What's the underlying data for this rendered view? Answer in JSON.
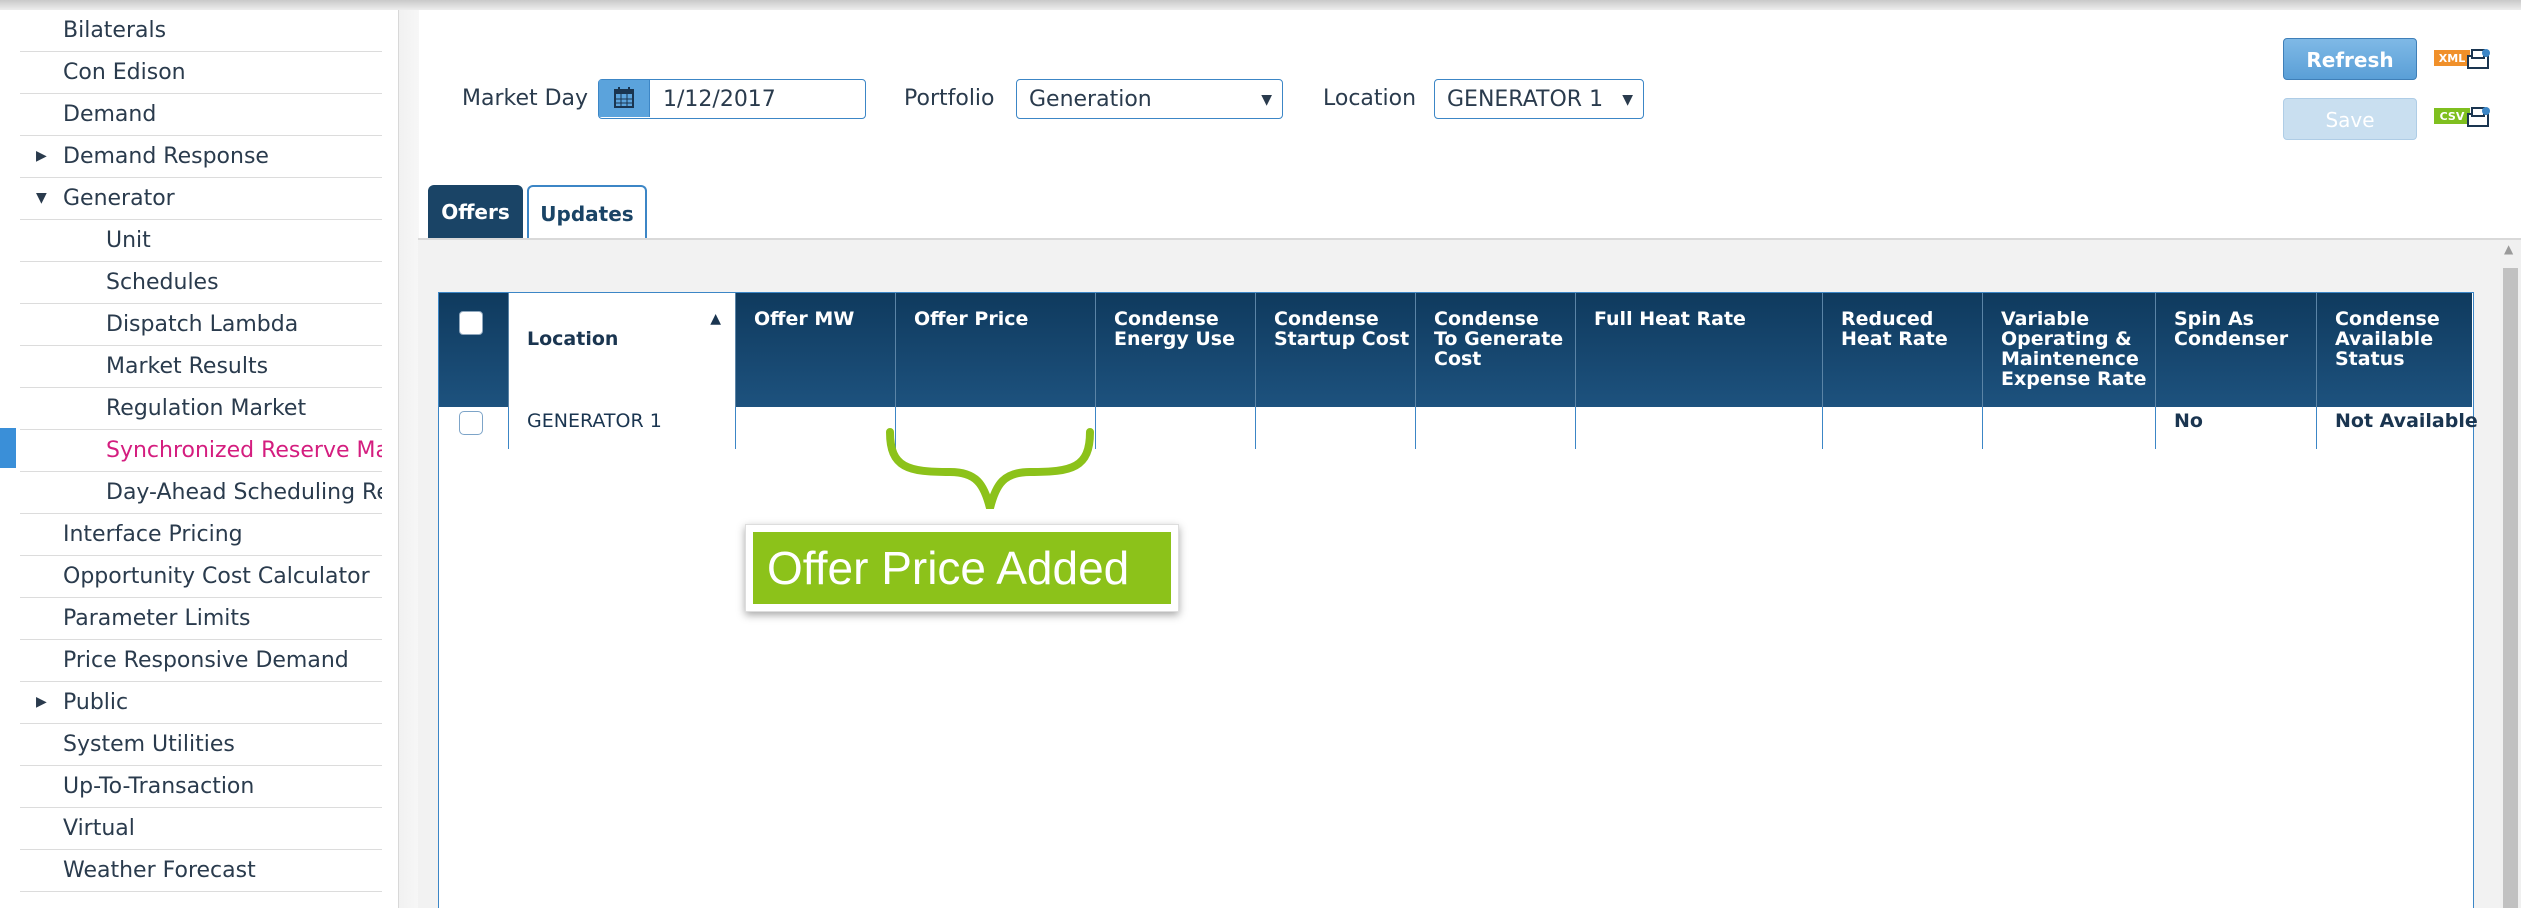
{
  "sidebar": {
    "items": [
      {
        "label": "Bilaterals"
      },
      {
        "label": "Con Edison"
      },
      {
        "label": "Demand"
      },
      {
        "label": "Demand Response"
      },
      {
        "label": "Generator"
      },
      {
        "label": "Unit"
      },
      {
        "label": "Schedules"
      },
      {
        "label": "Dispatch Lambda"
      },
      {
        "label": "Market Results"
      },
      {
        "label": "Regulation Market"
      },
      {
        "label": "Synchronized Reserve Mar"
      },
      {
        "label": "Day-Ahead Scheduling Res"
      },
      {
        "label": "Interface Pricing"
      },
      {
        "label": "Opportunity Cost Calculator"
      },
      {
        "label": "Parameter Limits"
      },
      {
        "label": "Price Responsive Demand"
      },
      {
        "label": "Public"
      },
      {
        "label": "System Utilities"
      },
      {
        "label": "Up-To-Transaction"
      },
      {
        "label": "Virtual"
      },
      {
        "label": "Weather Forecast"
      }
    ],
    "active_color": "#d41d7f"
  },
  "filters": {
    "market_day_label": "Market Day",
    "market_day_value": "1/12/2017",
    "portfolio_label": "Portfolio",
    "portfolio_value": "Generation",
    "location_label": "Location",
    "location_value": "GENERATOR 1"
  },
  "actions": {
    "refresh_label": "Refresh",
    "save_label": "Save",
    "xml_label": "XML",
    "csv_label": "CSV"
  },
  "tabs": {
    "offers": "Offers",
    "updates": "Updates"
  },
  "table": {
    "headers": [
      "Location",
      "Offer MW",
      "Offer Price",
      "Condense\nEnergy Use",
      "Condense\nStartup Cost",
      "Condense\nTo Generate\nCost",
      "Full Heat Rate",
      "Reduced\nHeat Rate",
      "Variable\nOperating &\nMaintenence\nExpense Rate",
      "Spin As\nCondenser",
      "Condense\nAvailable\nStatus"
    ],
    "rows": [
      {
        "location": "GENERATOR 1",
        "offer_mw": "",
        "offer_price": "",
        "condense_energy_use": "",
        "condense_startup_cost": "",
        "condense_to_generate_cost": "",
        "full_heat_rate": "",
        "reduced_heat_rate": "",
        "vom_rate": "",
        "spin_as_condenser": "No",
        "condense_available_status": "Not Available"
      }
    ]
  },
  "callout": {
    "text": "Offer Price Added",
    "color": "#8cc21a"
  },
  "colors": {
    "header_bg": "#1a4466",
    "accent_blue": "#3c86c6",
    "active_marker": "#3a8fd8"
  }
}
